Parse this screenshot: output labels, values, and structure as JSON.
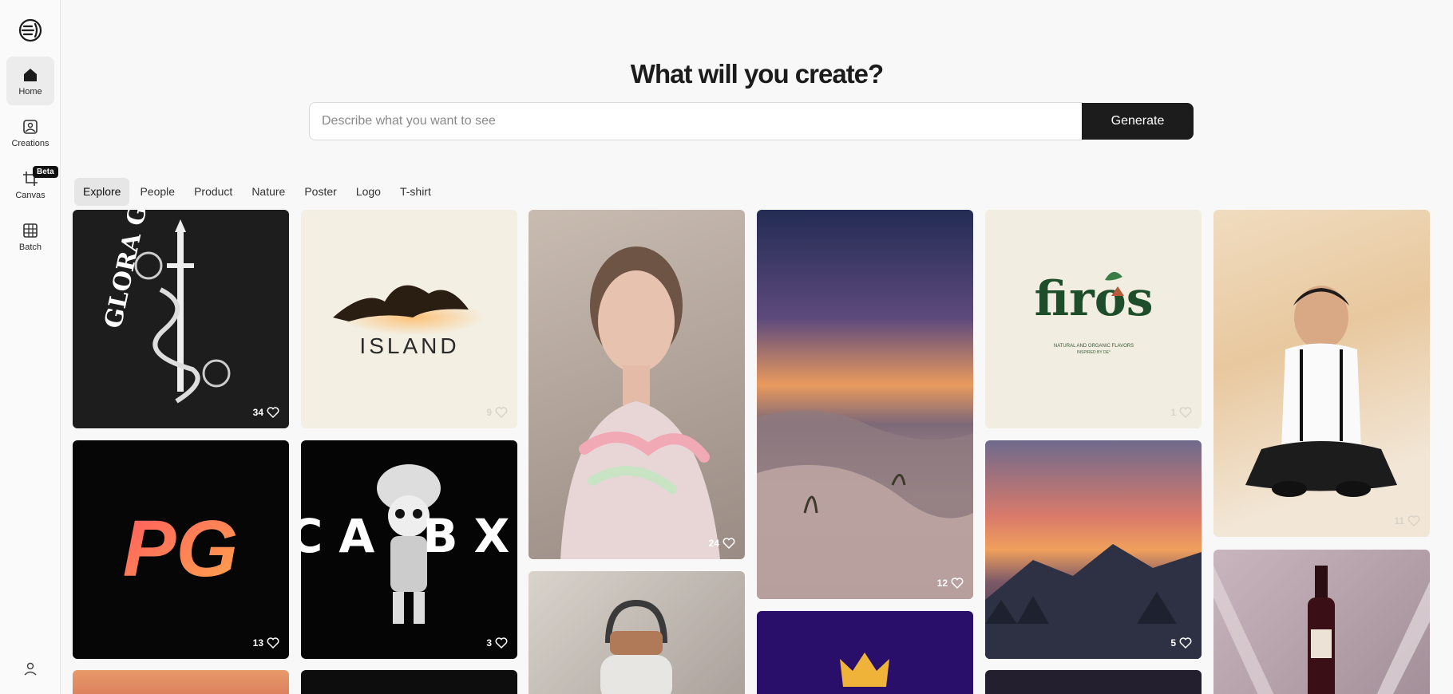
{
  "sidebar": {
    "items": [
      {
        "label": "Home",
        "icon": "home-icon",
        "active": true
      },
      {
        "label": "Creations",
        "icon": "image-icon"
      },
      {
        "label": "Canvas",
        "icon": "crop-icon",
        "badge": "Beta"
      },
      {
        "label": "Batch",
        "icon": "grid-icon"
      }
    ]
  },
  "hero": {
    "title": "What will you create?",
    "search_placeholder": "Describe what you want to see",
    "generate_label": "Generate"
  },
  "tabs": [
    "Explore",
    "People",
    "Product",
    "Nature",
    "Poster",
    "Logo",
    "T-shirt"
  ],
  "gallery": {
    "cards": [
      {
        "likes": "34",
        "text": "GLORA GLORA"
      },
      {
        "likes": "9",
        "text": "ISLAND"
      },
      {
        "likes": "24"
      },
      {
        "likes": "12"
      },
      {
        "likes": "1",
        "text": "firos",
        "subtext": "NATURAL AND ORGANIC FLAVORS",
        "subtext2": "INSPIRED BY DE°"
      },
      {
        "likes": "11"
      },
      {
        "likes": "13",
        "text": "PG"
      },
      {
        "likes": "3",
        "text": "RCA BXH"
      },
      {
        "likes": "5"
      }
    ]
  },
  "colors": {
    "accent": "#1c1c1c",
    "sidebar_active": "#ececec"
  }
}
